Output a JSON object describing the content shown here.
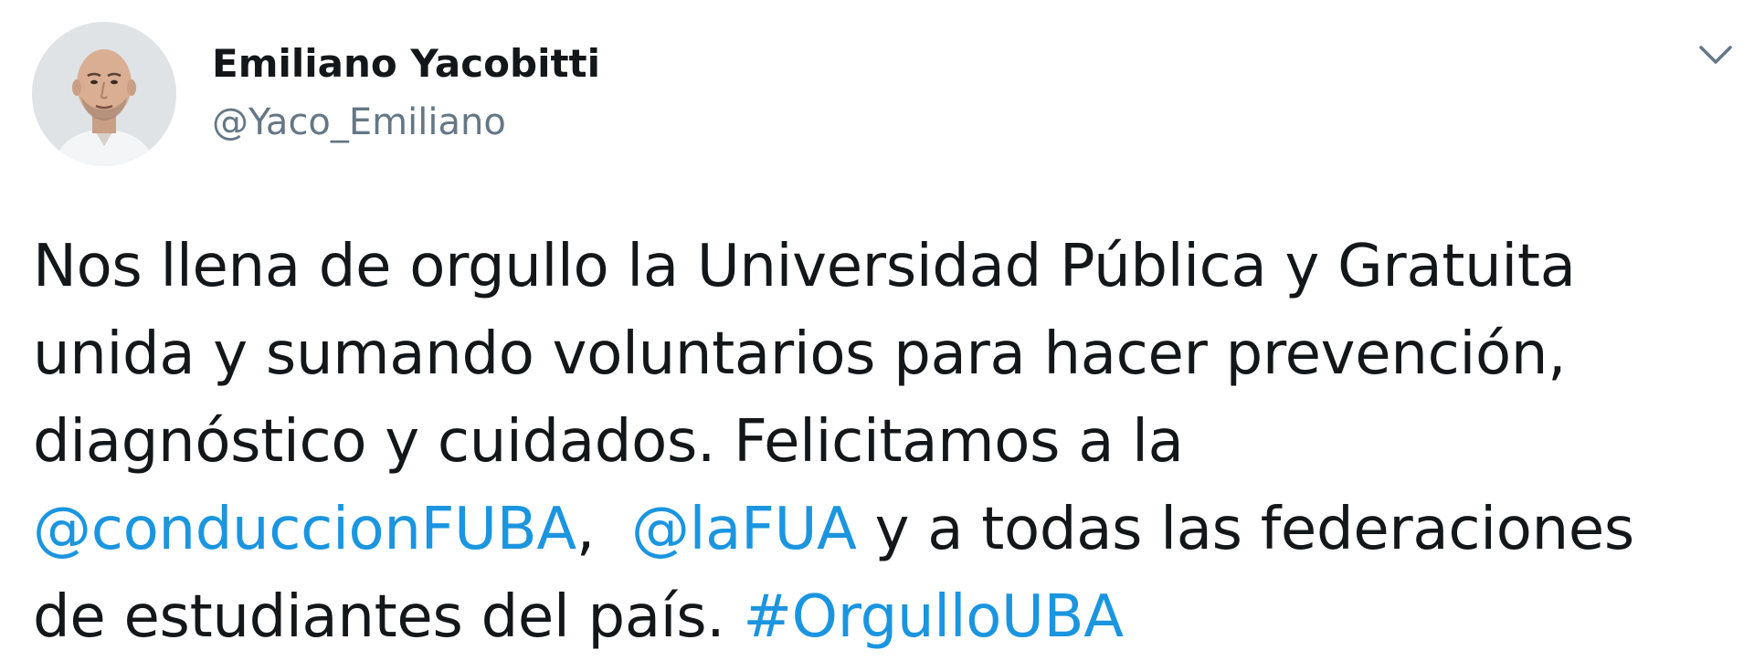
{
  "author": {
    "display_name": "Emiliano Yacobitti",
    "handle": "@Yaco_Emiliano"
  },
  "tweet": {
    "line1": "Nos llena de orgullo la Universidad Pública y Gratuita",
    "line2": "unida y sumando voluntarios para hacer prevención,",
    "line3": "diagnóstico y cuidados. Felicitamos a la",
    "mention1": "@conduccionFUBA",
    "sep": ",  ",
    "mention2": "@laFUA",
    "line4_rest": " y a todas las federaciones",
    "line5_pre": "de estudiantes del país. ",
    "hashtag": "#OrgulloUBA"
  },
  "icons": {
    "avatar": "profile-photo",
    "menu": "chevron-down-icon"
  },
  "colors": {
    "text": "#14171a",
    "secondary": "#657786",
    "link": "#1b95e0",
    "background": "#ffffff"
  }
}
